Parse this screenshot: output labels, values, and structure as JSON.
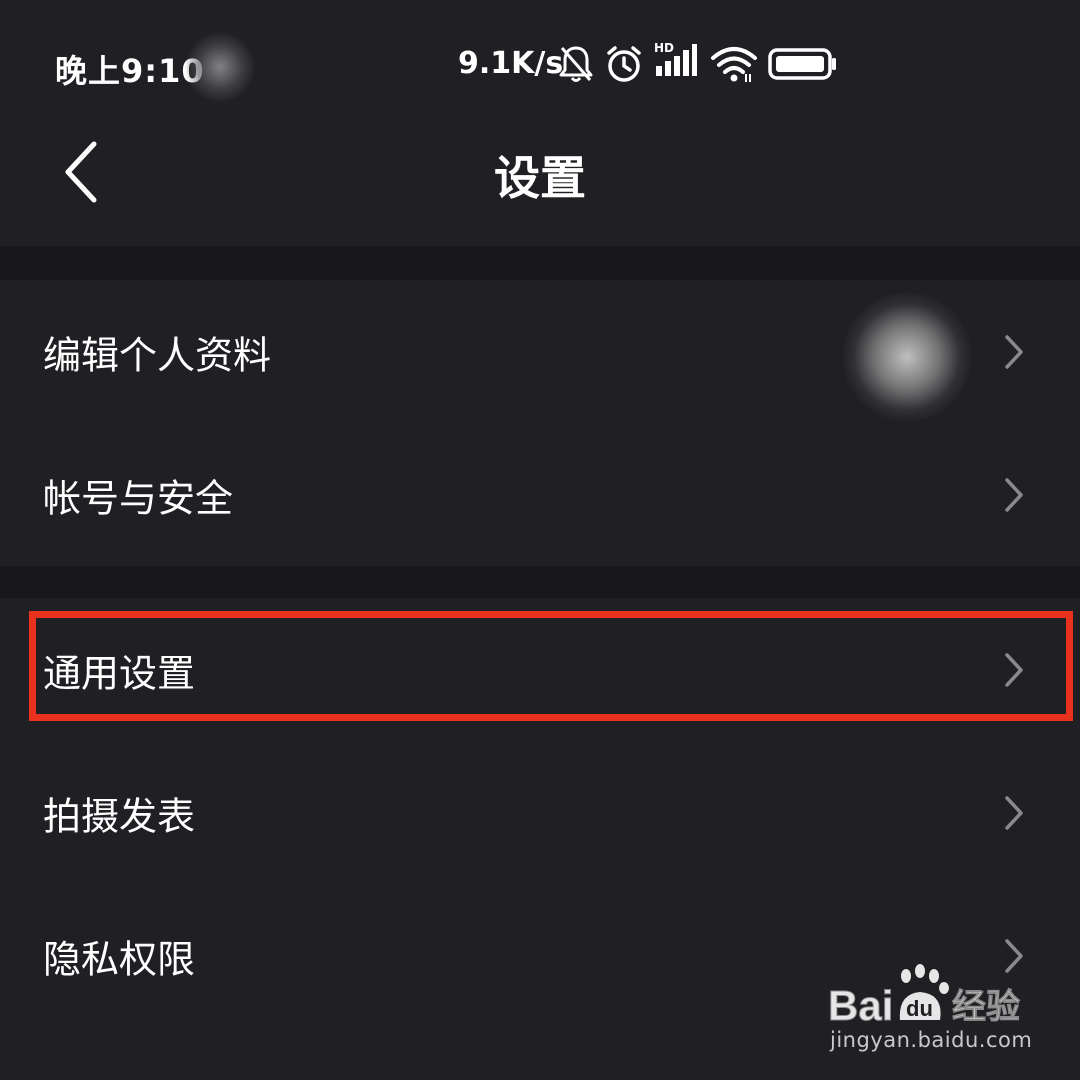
{
  "status_bar": {
    "time": "晚上9:10",
    "network_speed": "9.1K/s",
    "icons": [
      "bell-muted-icon",
      "alarm-icon",
      "hd-signal-icon",
      "wifi-icon",
      "battery-icon"
    ],
    "hd_label": "HD"
  },
  "nav": {
    "back_icon": "chevron-left-icon",
    "title": "设置"
  },
  "settings": {
    "items": [
      {
        "label": "编辑个人资料",
        "icon": "chevron-right-icon"
      },
      {
        "label": "帐号与安全",
        "icon": "chevron-right-icon"
      },
      {
        "label": "通用设置",
        "icon": "chevron-right-icon",
        "highlighted": true
      },
      {
        "label": "拍摄发表",
        "icon": "chevron-right-icon"
      },
      {
        "label": "隐私权限",
        "icon": "chevron-right-icon"
      }
    ]
  },
  "watermark": {
    "brand_text": "Bai",
    "du_text": "du",
    "suffix": "经验",
    "url": "jingyan.baidu.com"
  },
  "colors": {
    "background": "#202024",
    "separator": "#18181b",
    "highlight": "#e8321e",
    "chevron": "#8a8a8e"
  }
}
